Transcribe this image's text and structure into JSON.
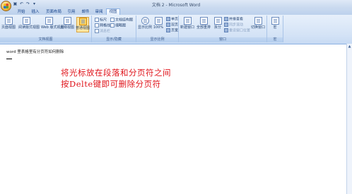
{
  "window": {
    "title": "文档 2 - Microsoft Word"
  },
  "qat": {
    "save_icon": "save-icon",
    "undo_icon": "undo-icon",
    "redo_icon": "redo-icon"
  },
  "tabs": [
    {
      "label": "开始"
    },
    {
      "label": "插入"
    },
    {
      "label": "页面布局"
    },
    {
      "label": "引用"
    },
    {
      "label": "邮件"
    },
    {
      "label": "审阅"
    },
    {
      "label": "视图"
    }
  ],
  "ribbon": {
    "views": {
      "print_layout": "页面视图",
      "full_screen_reading": "阅读版式视图",
      "web_layout": "Web 版式视图",
      "outline": "大纲视图",
      "draft": "普通视图",
      "group_label": "文档视图"
    },
    "show_hide": {
      "ruler": "标尺",
      "gridlines": "网格线",
      "message_bar": "消息栏",
      "doc_map": "文档结构图",
      "thumbnails": "缩略图",
      "group_label": "显示/隐藏"
    },
    "zoom": {
      "zoom": "显示比例",
      "percent": "100%",
      "one_page": "单页",
      "two_pages": "双页",
      "page_width": "页宽",
      "group_label": "显示比例"
    },
    "window": {
      "new_window": "新建窗口",
      "arrange_all": "全部重排",
      "split": "拆分",
      "side_by_side": "并排查看",
      "sync_scroll": "同步滚动",
      "reset_position": "重设窗口位置",
      "switch_windows": "切换窗口",
      "group_label": "窗口"
    },
    "macros": {
      "macros": "宏",
      "group_label": "宏"
    }
  },
  "document": {
    "first_line": "word 里表格里有分页符如何删除",
    "instruction_line1": "将光标放在段落和分页符之间",
    "instruction_line2": "按Delte键即可删除分页符"
  }
}
